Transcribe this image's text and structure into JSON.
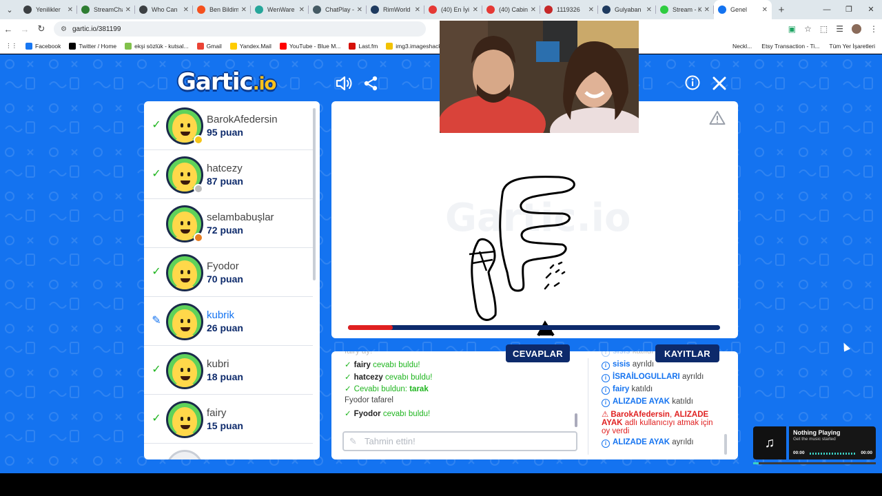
{
  "browser": {
    "tabs": [
      {
        "title": "Yenilikler",
        "color": "#3c4043"
      },
      {
        "title": "StreamCha",
        "color": "#2e7d32"
      },
      {
        "title": "Who Can",
        "color": "#3c4043"
      },
      {
        "title": "Ben Bildim",
        "color": "#f4511e"
      },
      {
        "title": "WenWare",
        "color": "#26a69a"
      },
      {
        "title": "ChatPlay -",
        "color": "#455a64"
      },
      {
        "title": "RimWorld",
        "color": "#1e3a5f"
      },
      {
        "title": "(40) En İyi",
        "color": "#e53935"
      },
      {
        "title": "(40) Cabin",
        "color": "#e53935"
      },
      {
        "title": "1119326",
        "color": "#c62828"
      },
      {
        "title": "Gulyaban",
        "color": "#1e3a5f"
      },
      {
        "title": "Stream - K",
        "color": "#2ecc40"
      },
      {
        "title": "Genel",
        "color": "#1473f0"
      }
    ],
    "url": "gartic.io/381199",
    "bookmarks": [
      {
        "label": "Facebook",
        "color": "#1877f2"
      },
      {
        "label": "Twitter / Home",
        "color": "#000000"
      },
      {
        "label": "ekşi sözlük - kutsal...",
        "color": "#81c14b"
      },
      {
        "label": "Gmail",
        "color": "#ea4335"
      },
      {
        "label": "Yandex.Mail",
        "color": "#ffcc00"
      },
      {
        "label": "YouTube - Blue M...",
        "color": "#ff0000"
      },
      {
        "label": "Last.fm",
        "color": "#d51007"
      },
      {
        "label": "img3.imageshack.us...",
        "color": "#f2c200"
      }
    ],
    "bookmarks_right": [
      "Neckl...",
      "Etsy Transaction - Ti...",
      "Tüm Yer İşaretleri"
    ]
  },
  "game": {
    "logo_main": "Gartic",
    "logo_io": ".io",
    "players": [
      {
        "name": "BarokAfedersin",
        "score": "95 puan",
        "status": "check",
        "badge": "#f5c518"
      },
      {
        "name": "hatcezy",
        "score": "87 puan",
        "status": "check",
        "badge": "#bdbdbd"
      },
      {
        "name": "selambabuşlar",
        "score": "72 puan",
        "status": "",
        "badge": "#e67e22"
      },
      {
        "name": "Fyodor",
        "score": "70 puan",
        "status": "check",
        "badge": ""
      },
      {
        "name": "kubrik",
        "score": "26 puan",
        "status": "drawing",
        "badge": ""
      },
      {
        "name": "kubri",
        "score": "18 puan",
        "status": "check",
        "badge": ""
      },
      {
        "name": "fairy",
        "score": "15 puan",
        "status": "check",
        "badge": ""
      }
    ],
    "timer_fraction": 0.12,
    "answers_button": "CEVAPLAR",
    "logs_button": "KAYITLAR",
    "answers": [
      {
        "type": "cut",
        "text": "fairy ay!"
      },
      {
        "type": "found",
        "name": "fairy",
        "text": "cevabı buldu!"
      },
      {
        "type": "found",
        "name": "hatcezy",
        "text": "cevabı buldu!"
      },
      {
        "type": "found-word",
        "text": "Cevabı buldun:",
        "word": "tarak"
      },
      {
        "type": "guess",
        "name": "Fyodor",
        "text": "tafarel"
      },
      {
        "type": "found",
        "name": "Fyodor",
        "text": "cevabı buldu!"
      }
    ],
    "guess_placeholder": "Tahmin ettin!",
    "logs": [
      {
        "name": "sisis",
        "text": "katıldı"
      },
      {
        "name": "sisis",
        "text": "ayrıldı"
      },
      {
        "name": "İSRAİLOGULLARI",
        "text": "ayrıldı"
      },
      {
        "name": "fairy",
        "text": "katıldı"
      },
      {
        "name": "ALIZADE AYAK",
        "text": "katıldı"
      },
      {
        "name": "BarokAfedersin",
        "mid": ", ",
        "name2": "ALIZADE AYAK",
        "text": "adlı kullanıcıyı atmak için oy verdi",
        "warn": true
      },
      {
        "name": "ALIZADE AYAK",
        "text": "ayrıldı"
      }
    ]
  },
  "music": {
    "title": "Nothing Playing",
    "subtitle": "Get the music started",
    "time_start": "00:00",
    "time_end": "00:00"
  }
}
